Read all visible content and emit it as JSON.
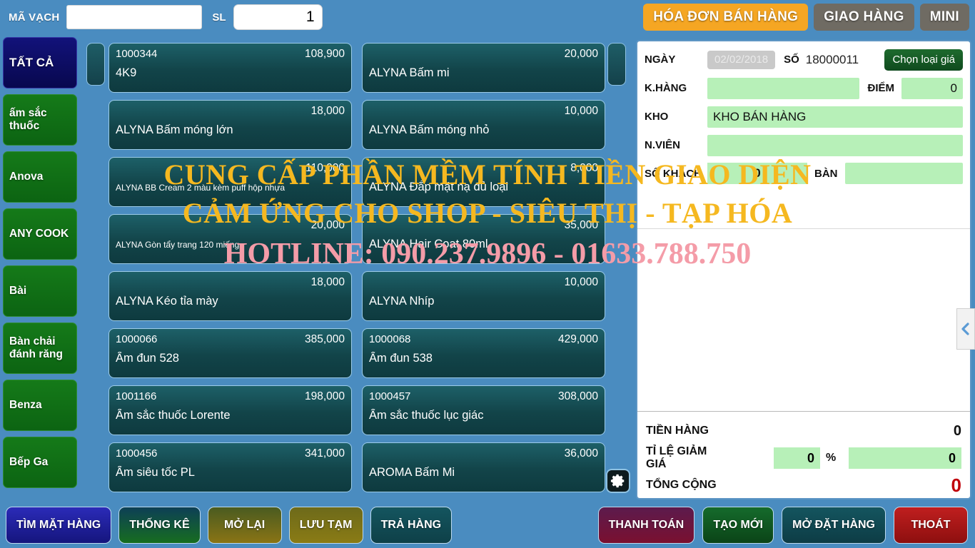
{
  "topbar": {
    "barcode_label": "MÃ VẠCH",
    "barcode_value": "",
    "barcode_placeholder": "",
    "qty_label": "SL",
    "qty_value": "1",
    "tabs": [
      {
        "label": "HÓA ĐƠN BÁN HÀNG",
        "active": true
      },
      {
        "label": "GIAO HÀNG",
        "active": false
      },
      {
        "label": "MINI",
        "active": false
      }
    ]
  },
  "categories": [
    {
      "label": "TẤT CẢ",
      "active": true
    },
    {
      "label": "ấm sắc thuốc",
      "active": false
    },
    {
      "label": "Anova",
      "active": false
    },
    {
      "label": "ANY COOK",
      "active": false
    },
    {
      "label": "Bài",
      "active": false
    },
    {
      "label": "Bàn chải đánh răng",
      "active": false
    },
    {
      "label": "Benza",
      "active": false
    },
    {
      "label": "Bếp Ga",
      "active": false
    }
  ],
  "products": [
    {
      "code": "1000344",
      "price": "108,900",
      "name": "4K9",
      "small": false
    },
    {
      "code": "",
      "price": "20,000",
      "name": "ALYNA Bấm mi",
      "small": false
    },
    {
      "code": "",
      "price": "18,000",
      "name": "ALYNA Bấm móng lớn",
      "small": false
    },
    {
      "code": "",
      "price": "10,000",
      "name": "ALYNA Bấm móng nhỏ",
      "small": false
    },
    {
      "code": "",
      "price": "110,000",
      "name": "ALYNA BB Cream 2 màu kèm puff hộp nhựa",
      "small": true
    },
    {
      "code": "",
      "price": "8,000",
      "name": "ALYNA Đắp mặt nạ đủ loại",
      "small": false
    },
    {
      "code": "",
      "price": "20,000",
      "name": "ALYNA Gòn tẩy trang 120 miếng",
      "small": true
    },
    {
      "code": "",
      "price": "35,000",
      "name": "ALYNA Hair Coat 80ml",
      "small": false
    },
    {
      "code": "",
      "price": "18,000",
      "name": "ALYNA Kéo tỉa mày",
      "small": false
    },
    {
      "code": "",
      "price": "10,000",
      "name": "ALYNA Nhíp",
      "small": false
    },
    {
      "code": "1000066",
      "price": "385,000",
      "name": "Ấm đun 528",
      "small": false
    },
    {
      "code": "1000068",
      "price": "429,000",
      "name": "Ấm đun 538",
      "small": false
    },
    {
      "code": "1001166",
      "price": "198,000",
      "name": "Ấm sắc thuốc Lorente",
      "small": false
    },
    {
      "code": "1000457",
      "price": "308,000",
      "name": "Ấm sắc thuốc lục giác",
      "small": false
    },
    {
      "code": "1000456",
      "price": "341,000",
      "name": "Ấm siêu tốc PL",
      "small": false
    },
    {
      "code": "",
      "price": "36,000",
      "name": "AROMA Bấm Mi",
      "small": false
    }
  ],
  "invoice": {
    "date_label": "NGÀY",
    "date_value": "02/02/2018",
    "so_label": "SỐ",
    "so_value": "18000011",
    "price_type_button": "Chọn loại giá",
    "customer_label": "K.HÀNG",
    "customer_value": "",
    "points_label": "ĐIỂM",
    "points_value": "0",
    "warehouse_label": "KHO",
    "warehouse_value": "KHO BÁN HÀNG",
    "staff_label": "N.VIÊN",
    "staff_value": "",
    "guests_label": "SỐ KHÁCH",
    "guests_value": "0",
    "table_label": "BÀN",
    "table_value": ""
  },
  "totals": {
    "subtotal_label": "TIỀN HÀNG",
    "subtotal_value": "0",
    "discount_label": "TỈ LỆ GIẢM GIÁ",
    "discount_pct": "0",
    "percent_sign": "%",
    "discount_amount": "0",
    "grand_label": "TỔNG CỘNG",
    "grand_value": "0"
  },
  "bottom_left_buttons": [
    {
      "label": "TÌM MẶT HÀNG"
    },
    {
      "label": "THỐNG KÊ"
    },
    {
      "label": "MỞ LẠI"
    },
    {
      "label": "LƯU TẠM"
    },
    {
      "label": "TRẢ HÀNG"
    }
  ],
  "bottom_right_buttons": [
    {
      "label": "THANH TOÁN"
    },
    {
      "label": "TẠO MỚI"
    },
    {
      "label": "MỞ ĐẶT HÀNG"
    },
    {
      "label": "THOÁT"
    }
  ],
  "watermark": {
    "line1": "CUNG CẤP PHẦN MỀM TÍNH TIỀN GIAO DIỆN",
    "line2": "CẢM ỨNG CHO SHOP - SIÊU THỊ - TẠP HÓA",
    "phone": "HOTLINE: 090.237.9896 - 01633.788.750"
  },
  "colors": {
    "app_background": "#4a8cc0",
    "accent_orange": "#f5a623",
    "category_green": "#14731a",
    "category_active": "#12127a",
    "cell_teal": "#124449",
    "field_green": "#b7f0b8",
    "total_red": "#c0000a",
    "watermark_gold": "#f5b820",
    "watermark_pink": "#f49ca8"
  }
}
